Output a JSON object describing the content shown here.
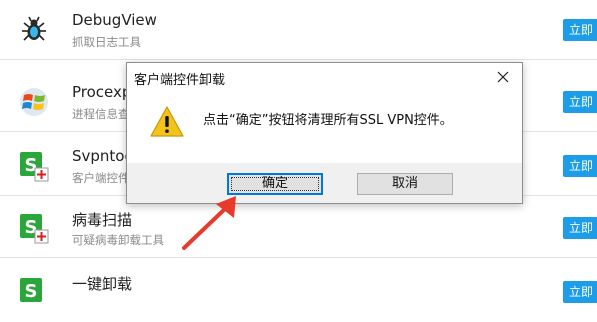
{
  "list": {
    "items": [
      {
        "title": "DebugView",
        "subtitle": "抓取日志工具",
        "button": "立即",
        "icon": "debugview-bug-icon"
      },
      {
        "title": "Procexp",
        "subtitle": "进程信息查",
        "button": "立即",
        "icon": "windows-logo-icon"
      },
      {
        "title": "Svpntool",
        "subtitle": "客户端控件",
        "button": "立即",
        "icon": "sangfor-s-plus-icon"
      },
      {
        "title": "病毒扫描",
        "subtitle": "可疑病毒卸载工具",
        "button": "立即",
        "icon": "sangfor-s-plus-icon"
      },
      {
        "title": "一键卸载",
        "subtitle": "",
        "button": "立即",
        "icon": "sangfor-s-plus-icon"
      }
    ],
    "button_color": "#1d9ce8"
  },
  "dialog": {
    "title": "客户端控件卸载",
    "message": "点击“确定”按钮将清理所有SSL VPN控件。",
    "ok_label": "确定",
    "cancel_label": "取消",
    "icon": "warning-icon"
  },
  "annotation": {
    "icon": "red-arrow-icon",
    "color": "#e83a2b"
  }
}
